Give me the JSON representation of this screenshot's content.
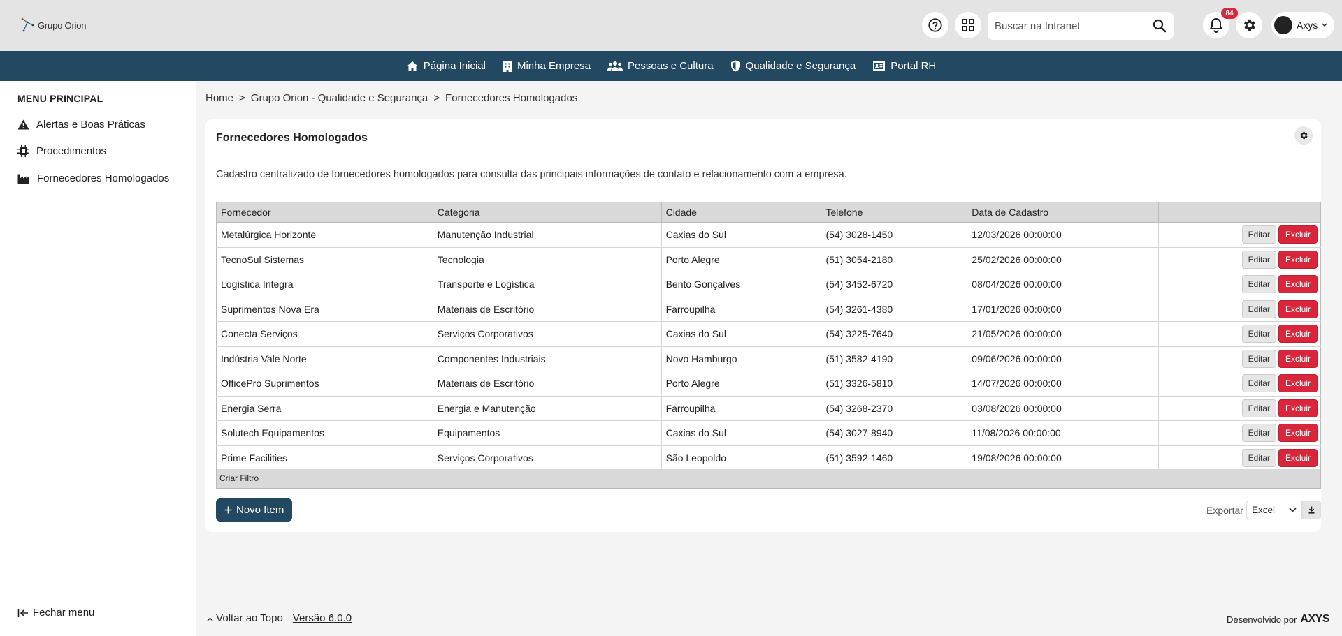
{
  "header": {
    "logo_text": "Grupo Orion",
    "search_placeholder": "Buscar na Intranet",
    "notifications_count": "84",
    "user_name": "Axys"
  },
  "nav": {
    "items": [
      {
        "label": "Página Inicial",
        "icon": "home-icon"
      },
      {
        "label": "Minha Empresa",
        "icon": "building-icon"
      },
      {
        "label": "Pessoas e Cultura",
        "icon": "people-icon"
      },
      {
        "label": "Qualidade e Segurança",
        "icon": "shield-icon"
      },
      {
        "label": "Portal RH",
        "icon": "id-card-icon"
      }
    ]
  },
  "sidebar": {
    "title": "MENU PRINCIPAL",
    "items": [
      {
        "label": "Alertas e Boas Práticas",
        "icon": "warning-icon"
      },
      {
        "label": "Procedimentos",
        "icon": "chip-icon"
      },
      {
        "label": "Fornecedores Homologados",
        "icon": "factory-icon"
      }
    ],
    "close_label": "Fechar menu"
  },
  "breadcrumb": [
    "Home",
    ">",
    "Grupo Orion - Qualidade e Segurança",
    ">",
    "Fornecedores Homologados"
  ],
  "card": {
    "title": "Fornecedores Homologados",
    "description": "Cadastro centralizado de fornecedores homologados para consulta das principais informações de contato e relacionamento com a empresa."
  },
  "table": {
    "columns": [
      "Fornecedor",
      "Categoria",
      "Cidade",
      "Telefone",
      "Data de Cadastro",
      ""
    ],
    "rows": [
      [
        "Metalúrgica Horizonte",
        "Manutenção Industrial",
        "Caxias do Sul",
        "(54) 3028-1450",
        "12/03/2026 00:00:00"
      ],
      [
        "TecnoSul Sistemas",
        "Tecnologia",
        "Porto Alegre",
        "(51) 3054-2180",
        "25/02/2026 00:00:00"
      ],
      [
        "Logística Integra",
        "Transporte e Logística",
        "Bento Gonçalves",
        "(54) 3452-6720",
        "08/04/2026 00:00:00"
      ],
      [
        "Suprimentos Nova Era",
        "Materiais de Escritório",
        "Farroupilha",
        "(54) 3261-4380",
        "17/01/2026 00:00:00"
      ],
      [
        "Conecta Serviços",
        "Serviços Corporativos",
        "Caxias do Sul",
        "(54) 3225-7640",
        "21/05/2026 00:00:00"
      ],
      [
        "Indústria Vale Norte",
        "Componentes Industriais",
        "Novo Hamburgo",
        "(51) 3582-4190",
        "09/06/2026 00:00:00"
      ],
      [
        "OfficePro Suprimentos",
        "Materiais de Escritório",
        "Porto Alegre",
        "(51) 3326-5810",
        "14/07/2026 00:00:00"
      ],
      [
        "Energia Serra",
        "Energia e Manutenção",
        "Farroupilha",
        "(54) 3268-2370",
        "03/08/2026 00:00:00"
      ],
      [
        "Solutech Equipamentos",
        "Equipamentos",
        "Caxias do Sul",
        "(54) 3027-8940",
        "11/08/2026 00:00:00"
      ],
      [
        "Prime Facilities",
        "Serviços Corporativos",
        "São Leopoldo",
        "(51) 3592-1460",
        "19/08/2026 00:00:00"
      ]
    ],
    "edit_label": "Editar",
    "delete_label": "Excluir",
    "filter_label": "Criar Filtro"
  },
  "actions": {
    "new_item_label": "Novo Item",
    "export_label": "Exportar",
    "export_value": "Excel"
  },
  "footer": {
    "back_to_top": "Voltar ao Topo",
    "version": "Versão 6.0.0",
    "developed_by": "Desenvolvido por",
    "brand": "AXYS"
  },
  "colors": {
    "primary": "#234862",
    "danger": "#d9263a",
    "header_bg": "#e4e4e4"
  }
}
